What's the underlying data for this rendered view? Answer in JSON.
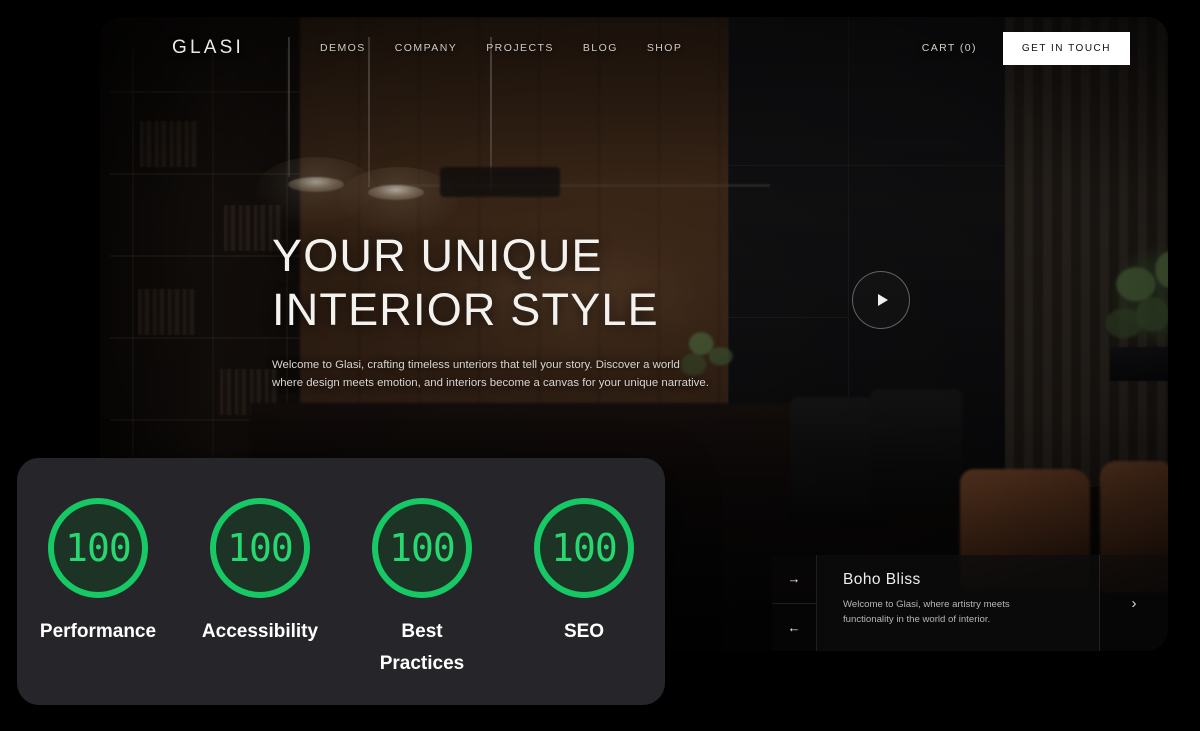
{
  "header": {
    "logo": "GLASI",
    "nav": [
      {
        "label": "DEMOS"
      },
      {
        "label": "COMPANY"
      },
      {
        "label": "PROJECTS"
      },
      {
        "label": "BLOG"
      },
      {
        "label": "SHOP"
      }
    ],
    "cart": "CART  (0)",
    "cta_label": "GET IN TOUCH"
  },
  "hero": {
    "title_line1": "YOUR UNIQUE",
    "title_line2": "INTERIOR STYLE",
    "subtitle": "Welcome to Glasi, crafting timeless unteriors that tell your story. Discover a world where design meets emotion, and interiors become a canvas for your unique narrative.",
    "play_icon": "play-icon"
  },
  "carousel": {
    "title": "Boho Bliss",
    "description": "Welcome to Glasi, where artistry meets functionality in the world of interior.",
    "arrow_next": "→",
    "arrow_prev": "←",
    "chevron_next": "›"
  },
  "lighthouse": {
    "scores": [
      {
        "value": "100",
        "label": "Performance"
      },
      {
        "value": "100",
        "label": "Accessibility"
      },
      {
        "value": "100",
        "label": "Best Practices"
      },
      {
        "value": "100",
        "label": "SEO"
      }
    ],
    "accent_color": "#16c964",
    "value_color": "#27d871",
    "panel_color": "#26262a"
  }
}
